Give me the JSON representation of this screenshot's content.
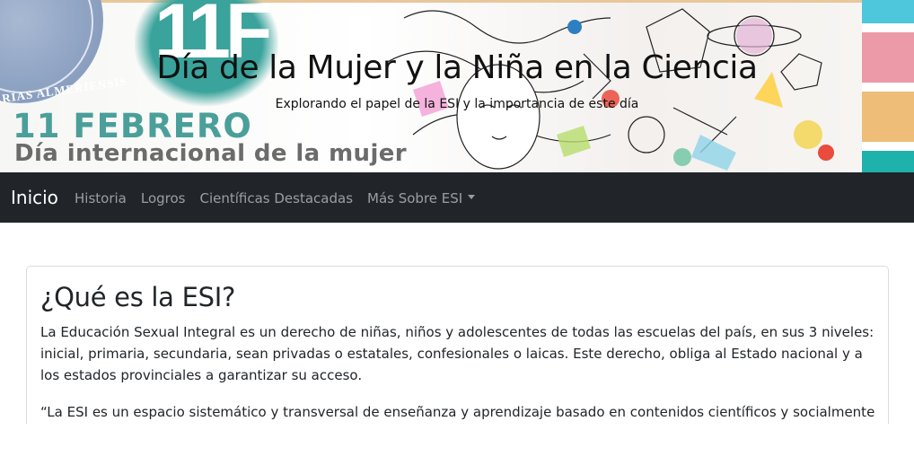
{
  "hero": {
    "title": "Día de la Mujer y la Niña en la Ciencia",
    "subtitle": "Explorando el papel de la ESI y la importancia de este día",
    "image": {
      "seal_text": "ERIAS ALMERIENSIS",
      "logo_letters": "11F",
      "date_text": "11 FEBRERO",
      "intl_text": "Día internacional de la mujer",
      "side_colors": [
        "#4ec6dc",
        "#ec9aa7",
        "#eebd77",
        "#1fb1ab"
      ]
    }
  },
  "navbar": {
    "brand": "Inicio",
    "links": [
      "Historia",
      "Logros",
      "Científicas Destacadas",
      "Más Sobre ESI"
    ],
    "dropdown_icon": "caret-down-icon"
  },
  "card": {
    "title": "¿Qué es la ESI?",
    "paragraph1": "La Educación Sexual Integral es un derecho de niñas, niños y adolescentes de todas las escuelas del país, en sus 3 niveles: inicial, primaria, secundaria, sean privadas o estatales, confesionales o laicas. Este derecho, obliga al Estado nacional y a los estados provinciales a garantizar su acceso.",
    "paragraph2": "“La ESI es un espacio sistemático y transversal de enseñanza y aprendizaje basado en contenidos científicos y socialmente"
  }
}
